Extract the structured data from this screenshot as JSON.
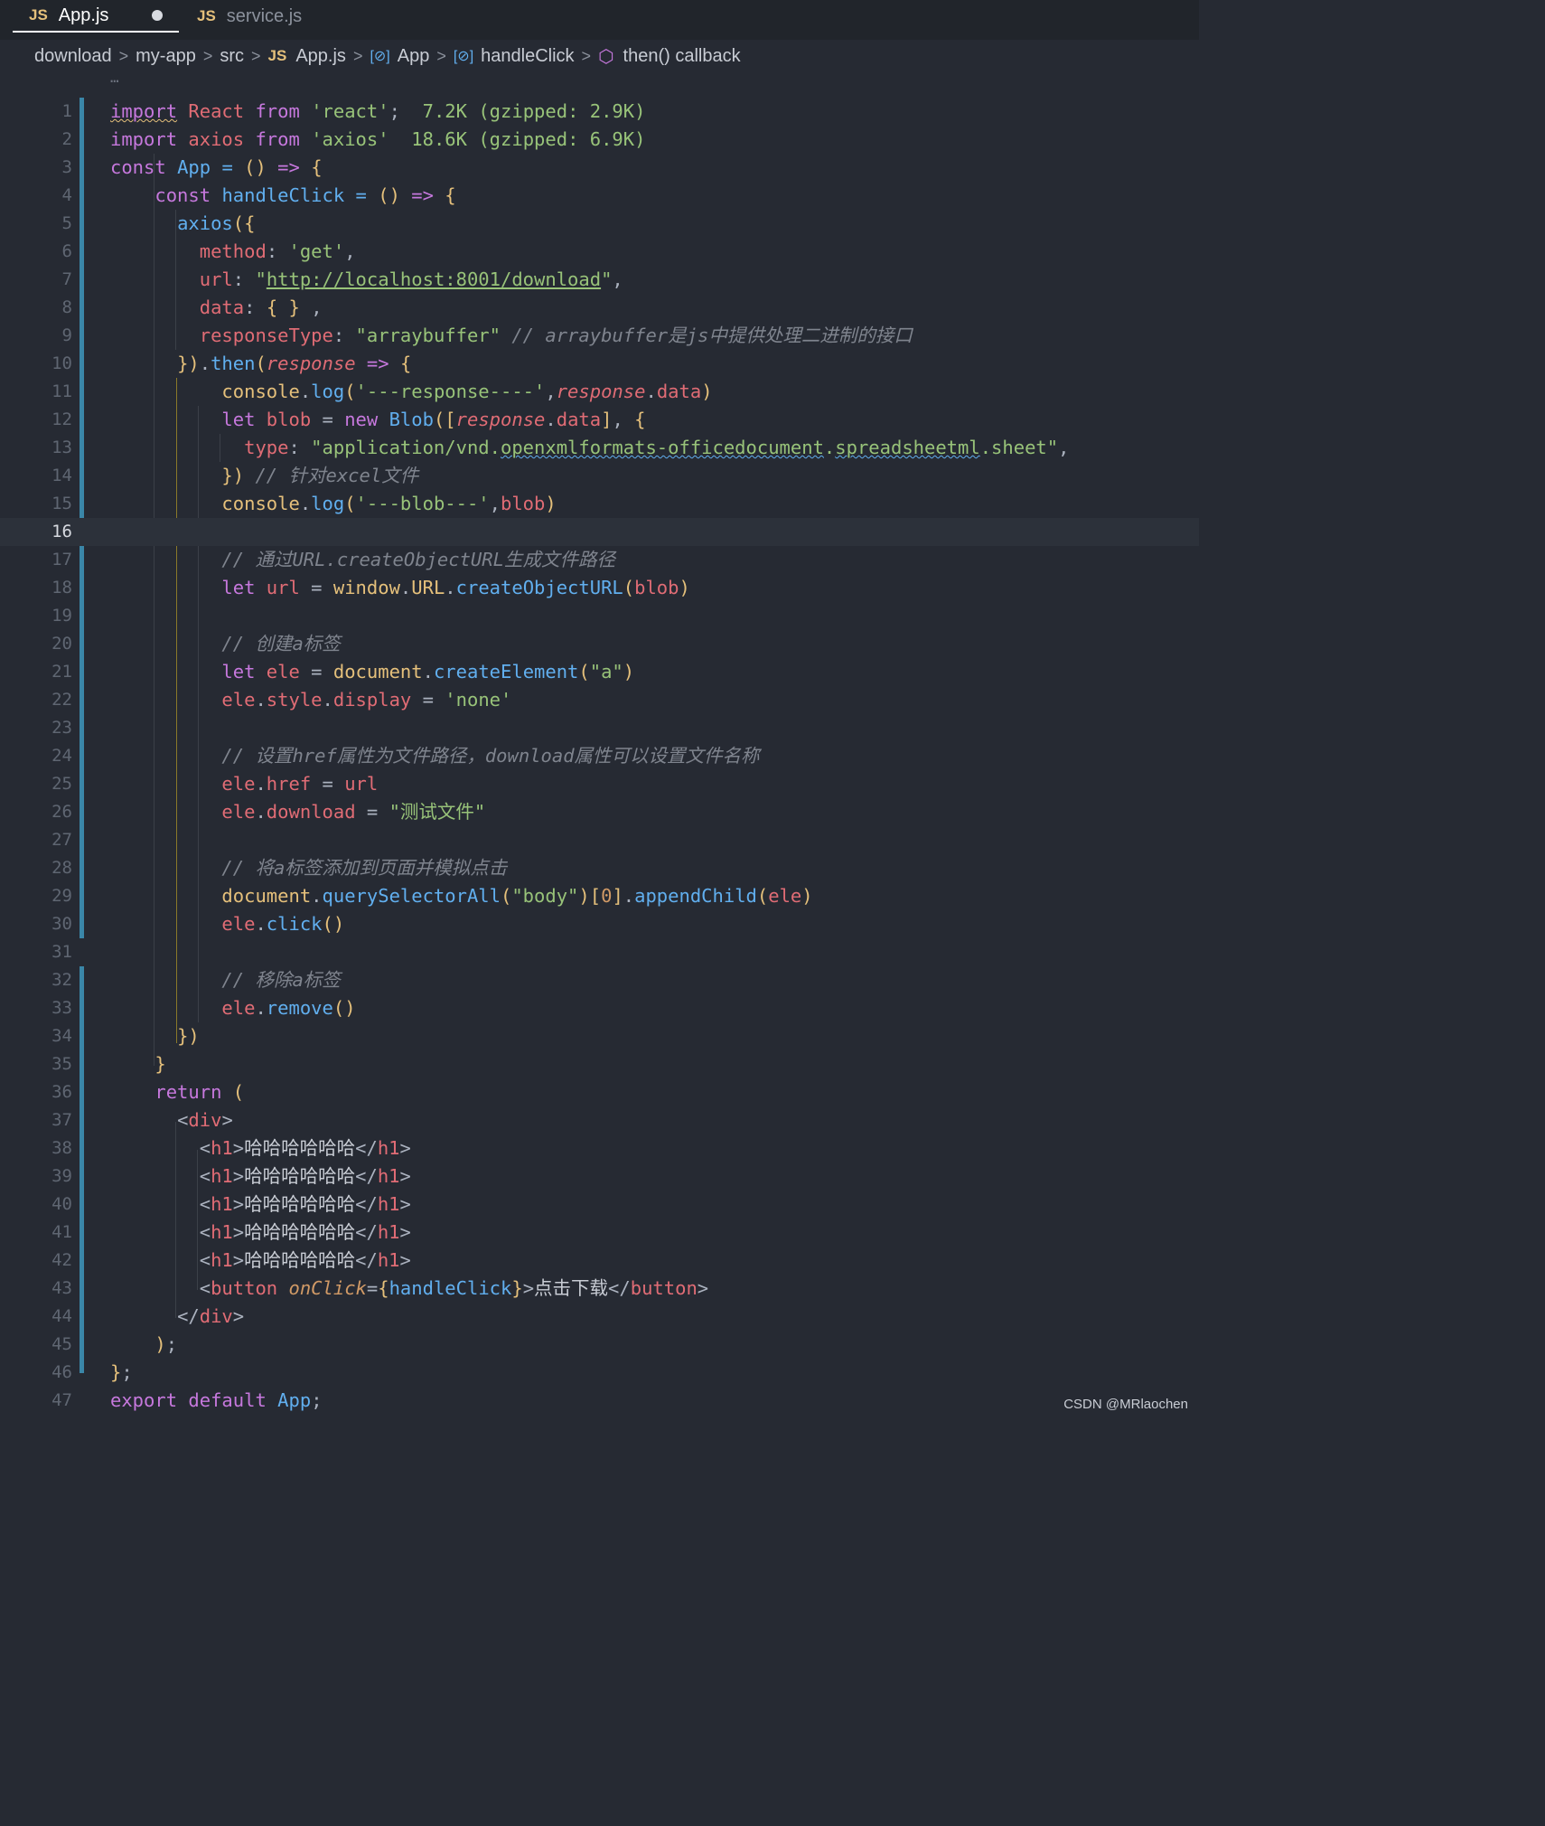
{
  "tabs": [
    {
      "icon": "JS",
      "label": "App.js",
      "active": true,
      "modified": true
    },
    {
      "icon": "JS",
      "label": "service.js",
      "active": false
    }
  ],
  "breadcrumb": [
    "download",
    "my-app",
    "src",
    "App.js",
    "App",
    "handleClick",
    "then() callback"
  ],
  "editor": {
    "current_line": 16,
    "line_numbers": [
      "1",
      "2",
      "3",
      "4",
      "5",
      "6",
      "7",
      "8",
      "9",
      "10",
      "11",
      "12",
      "13",
      "14",
      "15",
      "16",
      "17",
      "18",
      "19",
      "20",
      "21",
      "22",
      "23",
      "24",
      "25",
      "26",
      "27",
      "28",
      "29",
      "30",
      "31",
      "32",
      "33",
      "34",
      "35",
      "36",
      "37",
      "38",
      "39",
      "40",
      "41",
      "42",
      "43",
      "44",
      "45",
      "46",
      "47"
    ],
    "lines": [
      "import React from 'react';  7.2K (gzipped: 2.9K)",
      "import axios from 'axios'  18.6K (gzipped: 6.9K)",
      "const App = () => {",
      "    const handleClick = () => {",
      "      axios({",
      "        method: 'get',",
      "        url: \"http://localhost:8001/download\",",
      "        data: { } ,",
      "        responseType: \"arraybuffer\" // arraybuffer是js中提供处理二进制的接口",
      "      }).then(response => {",
      "          console.log('---response----',response.data)",
      "          let blob = new Blob([response.data], {",
      "            type: \"application/vnd.openxmlformats-officedocument.spreadsheetml.sheet\",",
      "          }) // 针对excel文件",
      "          console.log('---blob---',blob)",
      "",
      "          // 通过URL.createObjectURL生成文件路径",
      "          let url = window.URL.createObjectURL(blob)",
      "",
      "          // 创建a标签",
      "          let ele = document.createElement(\"a\")",
      "          ele.style.display = 'none'",
      "",
      "          // 设置href属性为文件路径，download属性可以设置文件名称",
      "          ele.href = url",
      "          ele.download = \"测试文件\"",
      "",
      "          // 将a标签添加到页面并模拟点击",
      "          document.querySelectorAll(\"body\")[0].appendChild(ele)",
      "          ele.click()",
      "",
      "          // 移除a标签",
      "          ele.remove()",
      "      })",
      "    }",
      "    return (",
      "      <div>",
      "        <h1>哈哈哈哈哈哈</h1>",
      "        <h1>哈哈哈哈哈哈</h1>",
      "        <h1>哈哈哈哈哈哈</h1>",
      "        <h1>哈哈哈哈哈哈</h1>",
      "        <h1>哈哈哈哈哈哈</h1>",
      "        <button onClick={handleClick}>点击下载</button>",
      "      </div>",
      "    );",
      "};",
      "export default App;"
    ]
  },
  "watermark": "CSDN @MRlaochen",
  "colors": {
    "background": "#262a33",
    "keyword": "#c678dd",
    "function": "#61afef",
    "string": "#98c379",
    "variable": "#e06c75",
    "type": "#e5c07b",
    "comment": "#7f848e"
  }
}
